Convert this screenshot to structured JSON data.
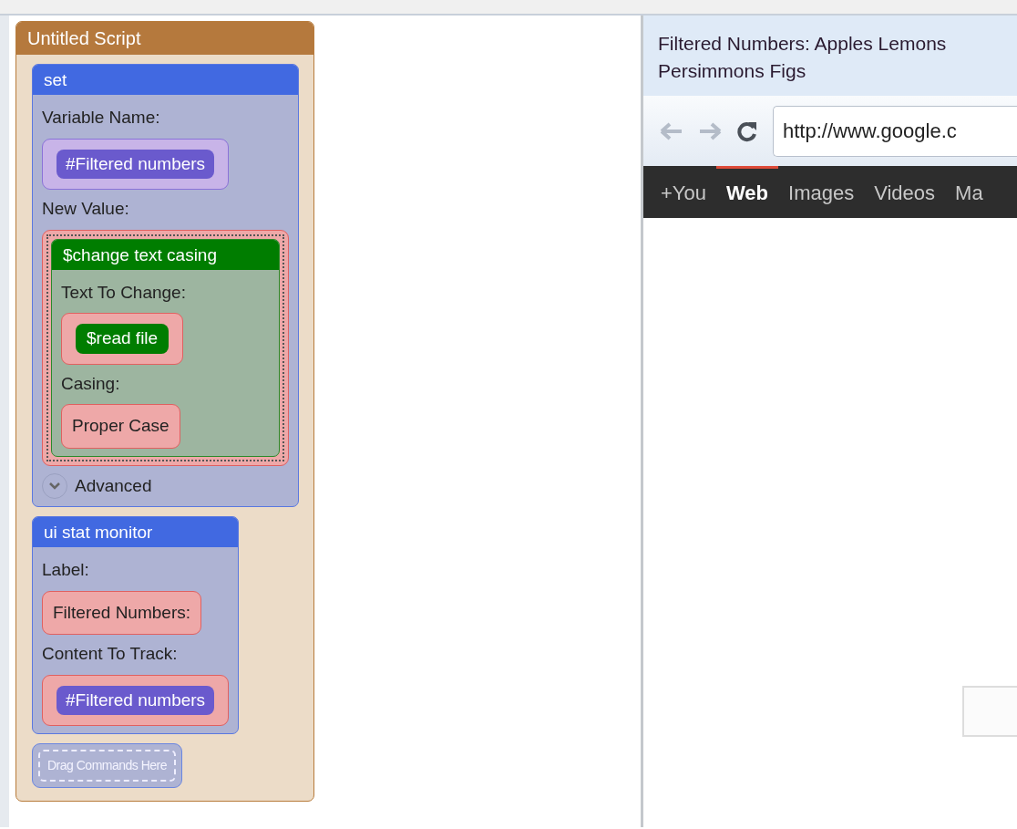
{
  "script": {
    "title": "Untitled Script",
    "commands": [
      {
        "title": "set",
        "params": [
          {
            "label": "Variable Name:",
            "variable_slot": true,
            "value": {
              "kind": "variable",
              "text": "#Filtered numbers"
            }
          },
          {
            "label": "New Value:",
            "variable_slot": false,
            "value": {
              "kind": "block",
              "title": "$change text casing",
              "params": [
                {
                  "label": "Text To Change:",
                  "variable_slot": false,
                  "value": {
                    "kind": "function",
                    "text": "$read file"
                  }
                },
                {
                  "label": "Casing:",
                  "variable_slot": false,
                  "value": {
                    "kind": "text",
                    "text": "Proper Case"
                  }
                }
              ]
            }
          }
        ],
        "advanced": {
          "label": "Advanced",
          "expanded": false
        }
      },
      {
        "title": "ui stat monitor",
        "params": [
          {
            "label": "Label:",
            "variable_slot": false,
            "value": {
              "kind": "text",
              "text": "Filtered Numbers:"
            }
          },
          {
            "label": "Content To Track:",
            "variable_slot": false,
            "value": {
              "kind": "variable",
              "text": "#Filtered numbers"
            }
          }
        ]
      }
    ],
    "drop_target": "Drag Commands Here"
  },
  "monitor": {
    "text": "Filtered Numbers: Apples Lemons Persimmons Figs"
  },
  "browser": {
    "url": "http://www.google.c",
    "nav_tabs": [
      {
        "label": "+You",
        "selected": false
      },
      {
        "label": "Web",
        "selected": true
      },
      {
        "label": "Images",
        "selected": false
      },
      {
        "label": "Videos",
        "selected": false
      },
      {
        "label": "Ma",
        "selected": false
      }
    ]
  }
}
